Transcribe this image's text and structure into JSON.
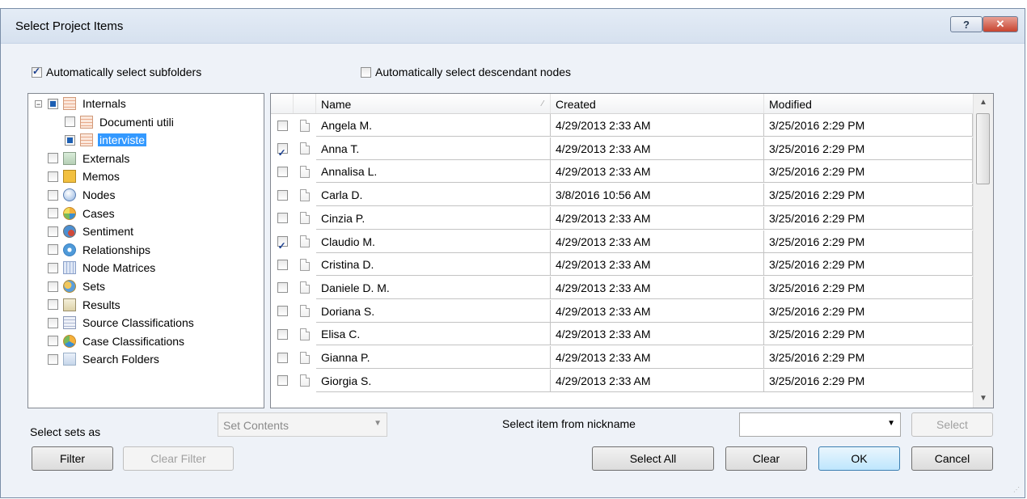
{
  "dialog": {
    "title": "Select Project Items",
    "help_label": "?",
    "close_label": "✕"
  },
  "options": {
    "auto_subfolders": {
      "label": "Automatically select subfolders",
      "checked": true
    },
    "auto_descendants": {
      "label": "Automatically select descendant nodes",
      "checked": false
    }
  },
  "tree": [
    {
      "label": "Internals",
      "icon": "internals-folder-icon",
      "state": "partial",
      "expander": "−",
      "level": 0
    },
    {
      "label": "Documenti utili",
      "icon": "folder-icon",
      "state": "unchecked",
      "level": 1
    },
    {
      "label": "interviste",
      "icon": "folder-icon",
      "state": "partial",
      "level": 1,
      "selected": true
    },
    {
      "label": "Externals",
      "icon": "externals-icon",
      "state": "unchecked",
      "level": 0
    },
    {
      "label": "Memos",
      "icon": "memo-icon",
      "state": "unchecked",
      "level": 0
    },
    {
      "label": "Nodes",
      "icon": "node-icon",
      "state": "unchecked",
      "level": 0
    },
    {
      "label": "Cases",
      "icon": "cases-icon",
      "state": "unchecked",
      "level": 0
    },
    {
      "label": "Sentiment",
      "icon": "sentiment-icon",
      "state": "unchecked",
      "level": 0
    },
    {
      "label": "Relationships",
      "icon": "relationships-icon",
      "state": "unchecked",
      "level": 0
    },
    {
      "label": "Node Matrices",
      "icon": "matrix-icon",
      "state": "unchecked",
      "level": 0
    },
    {
      "label": "Sets",
      "icon": "sets-icon",
      "state": "unchecked",
      "level": 0
    },
    {
      "label": "Results",
      "icon": "results-icon",
      "state": "unchecked",
      "level": 0
    },
    {
      "label": "Source Classifications",
      "icon": "source-classification-icon",
      "state": "unchecked",
      "level": 0
    },
    {
      "label": "Case Classifications",
      "icon": "case-classification-icon",
      "state": "unchecked",
      "level": 0
    },
    {
      "label": "Search Folders",
      "icon": "search-folder-icon",
      "state": "unchecked",
      "level": 0
    }
  ],
  "grid": {
    "columns": [
      "Name",
      "Created",
      "Modified"
    ],
    "sort_indicator": "⁄",
    "scroll_up": "▲",
    "scroll_down": "▼",
    "rows": [
      {
        "name": "Angela M.",
        "created": "4/29/2013 2:33 AM",
        "modified": "3/25/2016 2:29 PM",
        "checked": false
      },
      {
        "name": "Anna T.",
        "created": "4/29/2013 2:33 AM",
        "modified": "3/25/2016 2:29 PM",
        "checked": true
      },
      {
        "name": "Annalisa L.",
        "created": "4/29/2013 2:33 AM",
        "modified": "3/25/2016 2:29 PM",
        "checked": false
      },
      {
        "name": "Carla D.",
        "created": "3/8/2016 10:56 AM",
        "modified": "3/25/2016 2:29 PM",
        "checked": false
      },
      {
        "name": "Cinzia P.",
        "created": "4/29/2013 2:33 AM",
        "modified": "3/25/2016 2:29 PM",
        "checked": false
      },
      {
        "name": "Claudio M.",
        "created": "4/29/2013 2:33 AM",
        "modified": "3/25/2016 2:29 PM",
        "checked": true
      },
      {
        "name": "Cristina D.",
        "created": "4/29/2013 2:33 AM",
        "modified": "3/25/2016 2:29 PM",
        "checked": false
      },
      {
        "name": "Daniele D. M.",
        "created": "4/29/2013 2:33 AM",
        "modified": "3/25/2016 2:29 PM",
        "checked": false
      },
      {
        "name": "Doriana S.",
        "created": "4/29/2013 2:33 AM",
        "modified": "3/25/2016 2:29 PM",
        "checked": false
      },
      {
        "name": "Elisa C.",
        "created": "4/29/2013 2:33 AM",
        "modified": "3/25/2016 2:29 PM",
        "checked": false
      },
      {
        "name": "Gianna P.",
        "created": "4/29/2013 2:33 AM",
        "modified": "3/25/2016 2:29 PM",
        "checked": false
      },
      {
        "name": "Giorgia S.",
        "created": "4/29/2013 2:33 AM",
        "modified": "3/25/2016 2:29 PM",
        "checked": false
      }
    ]
  },
  "bottom": {
    "select_sets_label": "Select sets as",
    "sets_combo_value": "Set Contents",
    "nickname_label": "Select item from nickname",
    "nickname_value": "",
    "combo_arrow": "▼",
    "select_button": "Select",
    "filter_button": "Filter",
    "clear_filter_button": "Clear Filter",
    "select_all_button": "Select All",
    "clear_button": "Clear",
    "ok_button": "OK",
    "cancel_button": "Cancel",
    "grip": "⋰"
  }
}
